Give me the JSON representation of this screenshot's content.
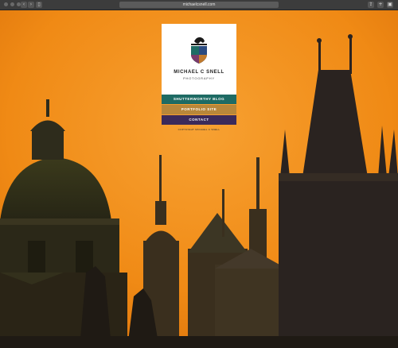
{
  "browser": {
    "url": "michaelcsnell.com"
  },
  "site": {
    "name": "MICHAEL C SNELL",
    "subtitle": "PHOTOGRAPHY",
    "menu": [
      {
        "label": "SHUTTERWORTHY BLOG"
      },
      {
        "label": "PORTFOLIO SITE"
      },
      {
        "label": "CONTACT"
      }
    ],
    "copyright": "COPYRIGHT MICHAEL C SNELL"
  },
  "colors": {
    "sky": "#f6941e",
    "blog": "#1e6b64",
    "portfolio": "#b8873a",
    "contact": "#3b2a5a"
  },
  "icons": {
    "sidebar": "sidebar-icon",
    "share": "share-icon",
    "tabs": "tabs-icon",
    "logo": "heraldic-lion-crest-icon"
  }
}
